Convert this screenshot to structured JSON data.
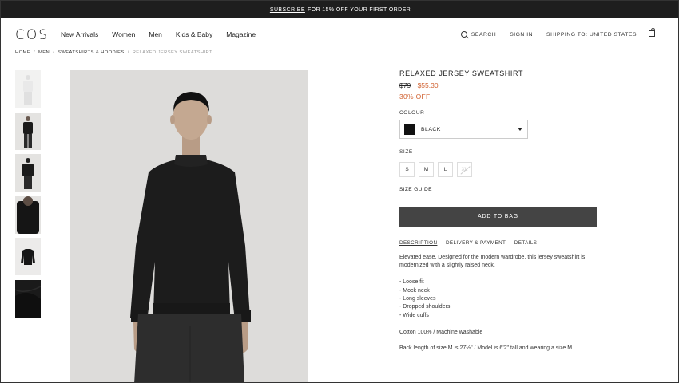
{
  "promo": {
    "link": "SUBSCRIBE",
    "text": "FOR 15% OFF YOUR FIRST ORDER"
  },
  "header": {
    "logo": "COS",
    "nav": [
      "New Arrivals",
      "Women",
      "Men",
      "Kids & Baby",
      "Magazine"
    ],
    "search": "SEARCH",
    "signin": "SIGN IN",
    "shipping": "SHIPPING TO: UNITED STATES"
  },
  "breadcrumb": [
    "HOME",
    "MEN",
    "SWEATSHIRTS & HOODIES",
    "RELAXED JERSEY SWEATSHIRT"
  ],
  "breadcrumb_sep": "/",
  "product": {
    "title": "RELAXED JERSEY SWEATSHIRT",
    "old_price": "$79",
    "new_price": "$55.30",
    "discount": "30% OFF",
    "colour_label": "COLOUR",
    "colour_value": "BLACK",
    "size_label": "SIZE",
    "sizes": [
      "S",
      "M",
      "L",
      "XL"
    ],
    "size_guide": "SIZE GUIDE",
    "add_to_bag": "ADD TO BAG",
    "tabs": [
      "DESCRIPTION",
      "DELIVERY & PAYMENT",
      "DETAILS"
    ],
    "tab_sep": "·",
    "description": "Elevated ease. Designed for the modern wardrobe, this jersey sweatshirt is modernized with a slightly raised neck.",
    "features": [
      "- Loose fit",
      "- Mock neck",
      "- Long sleeves",
      "- Dropped shoulders",
      "- Wide cuffs"
    ],
    "material": "Cotton 100% / Machine washable",
    "fit_note": "Back length of size M is 27½\" / Model is 6'2\" tall and wearing a size M"
  },
  "colors": {
    "sale": "#d0602f",
    "button": "#444444",
    "promo_bg": "#1e1e1e"
  }
}
